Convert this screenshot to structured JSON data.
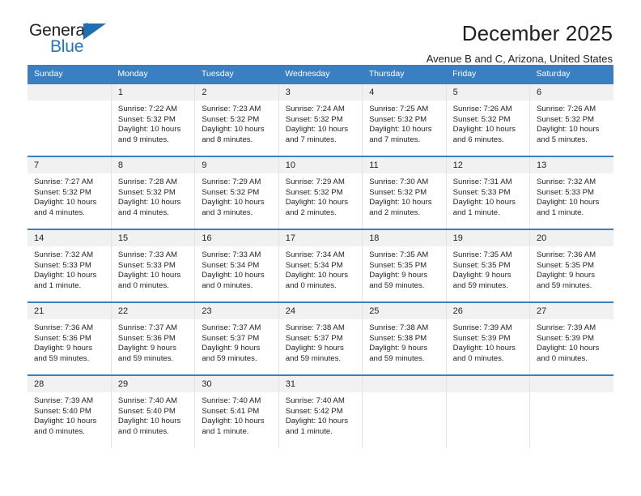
{
  "logo": {
    "word_top": "General",
    "word_bottom": "Blue",
    "triangle_icon": "triangle-icon",
    "brand_color": "#1f77bd"
  },
  "header": {
    "title": "December 2025",
    "subtitle": "Avenue B and C, Arizona, United States"
  },
  "calendar": {
    "header_color": "#3a7fc1",
    "weekday_headers": [
      "Sunday",
      "Monday",
      "Tuesday",
      "Wednesday",
      "Thursday",
      "Friday",
      "Saturday"
    ],
    "weeks": [
      [
        {
          "day": "",
          "sunrise": "",
          "sunset": "",
          "daylight": ""
        },
        {
          "day": "1",
          "sunrise": "Sunrise: 7:22 AM",
          "sunset": "Sunset: 5:32 PM",
          "daylight": "Daylight: 10 hours and 9 minutes."
        },
        {
          "day": "2",
          "sunrise": "Sunrise: 7:23 AM",
          "sunset": "Sunset: 5:32 PM",
          "daylight": "Daylight: 10 hours and 8 minutes."
        },
        {
          "day": "3",
          "sunrise": "Sunrise: 7:24 AM",
          "sunset": "Sunset: 5:32 PM",
          "daylight": "Daylight: 10 hours and 7 minutes."
        },
        {
          "day": "4",
          "sunrise": "Sunrise: 7:25 AM",
          "sunset": "Sunset: 5:32 PM",
          "daylight": "Daylight: 10 hours and 7 minutes."
        },
        {
          "day": "5",
          "sunrise": "Sunrise: 7:26 AM",
          "sunset": "Sunset: 5:32 PM",
          "daylight": "Daylight: 10 hours and 6 minutes."
        },
        {
          "day": "6",
          "sunrise": "Sunrise: 7:26 AM",
          "sunset": "Sunset: 5:32 PM",
          "daylight": "Daylight: 10 hours and 5 minutes."
        }
      ],
      [
        {
          "day": "7",
          "sunrise": "Sunrise: 7:27 AM",
          "sunset": "Sunset: 5:32 PM",
          "daylight": "Daylight: 10 hours and 4 minutes."
        },
        {
          "day": "8",
          "sunrise": "Sunrise: 7:28 AM",
          "sunset": "Sunset: 5:32 PM",
          "daylight": "Daylight: 10 hours and 4 minutes."
        },
        {
          "day": "9",
          "sunrise": "Sunrise: 7:29 AM",
          "sunset": "Sunset: 5:32 PM",
          "daylight": "Daylight: 10 hours and 3 minutes."
        },
        {
          "day": "10",
          "sunrise": "Sunrise: 7:29 AM",
          "sunset": "Sunset: 5:32 PM",
          "daylight": "Daylight: 10 hours and 2 minutes."
        },
        {
          "day": "11",
          "sunrise": "Sunrise: 7:30 AM",
          "sunset": "Sunset: 5:32 PM",
          "daylight": "Daylight: 10 hours and 2 minutes."
        },
        {
          "day": "12",
          "sunrise": "Sunrise: 7:31 AM",
          "sunset": "Sunset: 5:33 PM",
          "daylight": "Daylight: 10 hours and 1 minute."
        },
        {
          "day": "13",
          "sunrise": "Sunrise: 7:32 AM",
          "sunset": "Sunset: 5:33 PM",
          "daylight": "Daylight: 10 hours and 1 minute."
        }
      ],
      [
        {
          "day": "14",
          "sunrise": "Sunrise: 7:32 AM",
          "sunset": "Sunset: 5:33 PM",
          "daylight": "Daylight: 10 hours and 1 minute."
        },
        {
          "day": "15",
          "sunrise": "Sunrise: 7:33 AM",
          "sunset": "Sunset: 5:33 PM",
          "daylight": "Daylight: 10 hours and 0 minutes."
        },
        {
          "day": "16",
          "sunrise": "Sunrise: 7:33 AM",
          "sunset": "Sunset: 5:34 PM",
          "daylight": "Daylight: 10 hours and 0 minutes."
        },
        {
          "day": "17",
          "sunrise": "Sunrise: 7:34 AM",
          "sunset": "Sunset: 5:34 PM",
          "daylight": "Daylight: 10 hours and 0 minutes."
        },
        {
          "day": "18",
          "sunrise": "Sunrise: 7:35 AM",
          "sunset": "Sunset: 5:35 PM",
          "daylight": "Daylight: 9 hours and 59 minutes."
        },
        {
          "day": "19",
          "sunrise": "Sunrise: 7:35 AM",
          "sunset": "Sunset: 5:35 PM",
          "daylight": "Daylight: 9 hours and 59 minutes."
        },
        {
          "day": "20",
          "sunrise": "Sunrise: 7:36 AM",
          "sunset": "Sunset: 5:35 PM",
          "daylight": "Daylight: 9 hours and 59 minutes."
        }
      ],
      [
        {
          "day": "21",
          "sunrise": "Sunrise: 7:36 AM",
          "sunset": "Sunset: 5:36 PM",
          "daylight": "Daylight: 9 hours and 59 minutes."
        },
        {
          "day": "22",
          "sunrise": "Sunrise: 7:37 AM",
          "sunset": "Sunset: 5:36 PM",
          "daylight": "Daylight: 9 hours and 59 minutes."
        },
        {
          "day": "23",
          "sunrise": "Sunrise: 7:37 AM",
          "sunset": "Sunset: 5:37 PM",
          "daylight": "Daylight: 9 hours and 59 minutes."
        },
        {
          "day": "24",
          "sunrise": "Sunrise: 7:38 AM",
          "sunset": "Sunset: 5:37 PM",
          "daylight": "Daylight: 9 hours and 59 minutes."
        },
        {
          "day": "25",
          "sunrise": "Sunrise: 7:38 AM",
          "sunset": "Sunset: 5:38 PM",
          "daylight": "Daylight: 9 hours and 59 minutes."
        },
        {
          "day": "26",
          "sunrise": "Sunrise: 7:39 AM",
          "sunset": "Sunset: 5:39 PM",
          "daylight": "Daylight: 10 hours and 0 minutes."
        },
        {
          "day": "27",
          "sunrise": "Sunrise: 7:39 AM",
          "sunset": "Sunset: 5:39 PM",
          "daylight": "Daylight: 10 hours and 0 minutes."
        }
      ],
      [
        {
          "day": "28",
          "sunrise": "Sunrise: 7:39 AM",
          "sunset": "Sunset: 5:40 PM",
          "daylight": "Daylight: 10 hours and 0 minutes."
        },
        {
          "day": "29",
          "sunrise": "Sunrise: 7:40 AM",
          "sunset": "Sunset: 5:40 PM",
          "daylight": "Daylight: 10 hours and 0 minutes."
        },
        {
          "day": "30",
          "sunrise": "Sunrise: 7:40 AM",
          "sunset": "Sunset: 5:41 PM",
          "daylight": "Daylight: 10 hours and 1 minute."
        },
        {
          "day": "31",
          "sunrise": "Sunrise: 7:40 AM",
          "sunset": "Sunset: 5:42 PM",
          "daylight": "Daylight: 10 hours and 1 minute."
        },
        {
          "day": "",
          "sunrise": "",
          "sunset": "",
          "daylight": ""
        },
        {
          "day": "",
          "sunrise": "",
          "sunset": "",
          "daylight": ""
        },
        {
          "day": "",
          "sunrise": "",
          "sunset": "",
          "daylight": ""
        }
      ]
    ]
  }
}
